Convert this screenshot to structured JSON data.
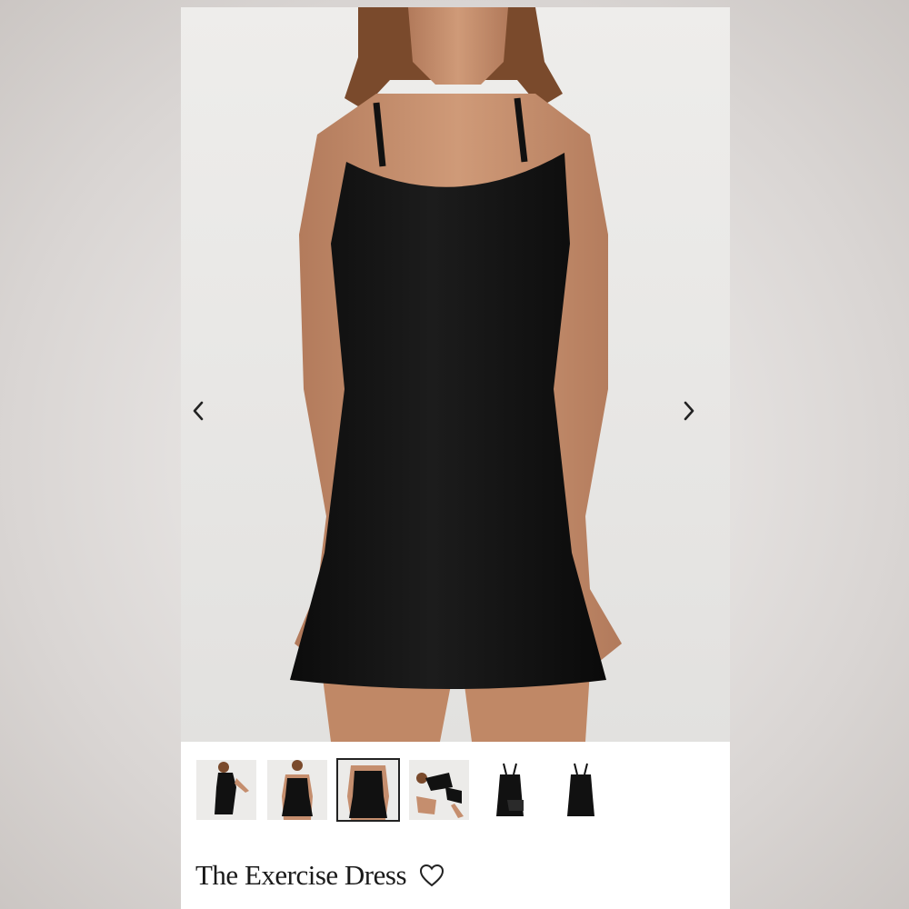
{
  "product": {
    "title": "The Exercise Dress"
  },
  "gallery": {
    "thumbnails": [
      {
        "name": "thumb-side-view"
      },
      {
        "name": "thumb-front-view"
      },
      {
        "name": "thumb-front-closeup",
        "selected": true
      },
      {
        "name": "thumb-kneeling-pose"
      },
      {
        "name": "thumb-flat-with-shorts"
      },
      {
        "name": "thumb-flat-dress"
      }
    ],
    "prev_icon": "chevron-left-icon",
    "next_icon": "chevron-right-icon"
  },
  "icons": {
    "wishlist": "heart-outline-icon"
  },
  "colors": {
    "dress": "#111111",
    "skin": "#c58e6e",
    "hair": "#7a4a2c",
    "background": "#e9e8e6"
  }
}
